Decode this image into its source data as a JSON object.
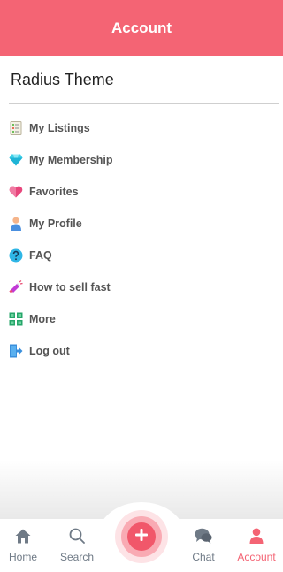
{
  "header": {
    "title": "Account"
  },
  "user": {
    "name": "Radius Theme"
  },
  "menu": [
    {
      "label": "My Listings",
      "icon": "list-icon"
    },
    {
      "label": "My Membership",
      "icon": "diamond-icon"
    },
    {
      "label": "Favorites",
      "icon": "heart-icon"
    },
    {
      "label": "My Profile",
      "icon": "profile-icon"
    },
    {
      "label": "FAQ",
      "icon": "question-icon"
    },
    {
      "label": "How to sell fast",
      "icon": "megaphone-icon"
    },
    {
      "label": "More",
      "icon": "grid-icon"
    },
    {
      "label": "Log out",
      "icon": "logout-icon"
    }
  ],
  "nav": {
    "home": "Home",
    "search": "Search",
    "chat": "Chat",
    "account": "Account"
  },
  "colors": {
    "accent": "#f46474",
    "nav_text": "#6f7a86"
  }
}
